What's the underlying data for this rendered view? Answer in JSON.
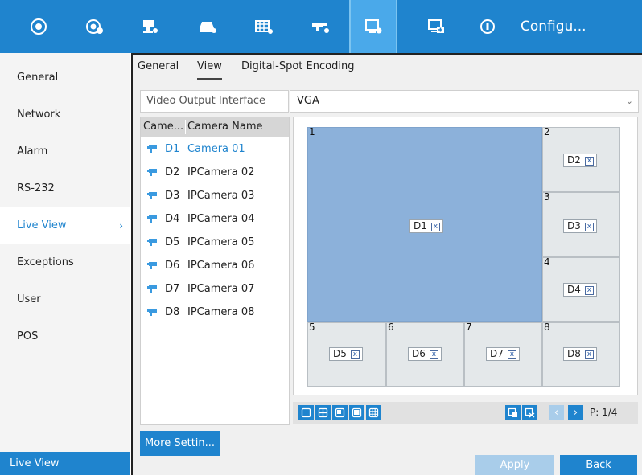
{
  "topbar": {
    "icons": [
      {
        "name": "playback-icon"
      },
      {
        "name": "camera-search-icon"
      },
      {
        "name": "record-icon"
      },
      {
        "name": "hdd-icon"
      },
      {
        "name": "video-config-icon"
      },
      {
        "name": "camera-config-icon"
      },
      {
        "name": "display-config-icon",
        "active": true
      },
      {
        "name": "system-config-icon"
      },
      {
        "name": "info-icon"
      }
    ],
    "title": "Configu..."
  },
  "sidebar": {
    "items": [
      {
        "label": "General"
      },
      {
        "label": "Network"
      },
      {
        "label": "Alarm"
      },
      {
        "label": "RS-232"
      },
      {
        "label": "Live View",
        "active": true
      },
      {
        "label": "Exceptions"
      },
      {
        "label": "User"
      },
      {
        "label": "POS"
      }
    ],
    "active_chevron": "›",
    "bottom_label": "Live View"
  },
  "tabs": [
    {
      "label": "General"
    },
    {
      "label": "View",
      "active": true
    },
    {
      "label": "Digital-Spot Encoding"
    }
  ],
  "output": {
    "label": "Video Output Interface",
    "value": "VGA",
    "arrow": "⌄"
  },
  "camera_list": {
    "headers": [
      "Came...",
      "Camera Name"
    ],
    "rows": [
      {
        "channel": "D1",
        "name": "Camera 01",
        "selected": true
      },
      {
        "channel": "D2",
        "name": "IPCamera 02"
      },
      {
        "channel": "D3",
        "name": "IPCamera 03"
      },
      {
        "channel": "D4",
        "name": "IPCamera 04"
      },
      {
        "channel": "D5",
        "name": "IPCamera 05"
      },
      {
        "channel": "D6",
        "name": "IPCamera 06"
      },
      {
        "channel": "D7",
        "name": "IPCamera 07"
      },
      {
        "channel": "D8",
        "name": "IPCamera 08"
      }
    ]
  },
  "layout": {
    "windows": [
      {
        "num": "1",
        "cam": "D1",
        "x_icon": "x"
      },
      {
        "num": "2",
        "cam": "D2",
        "x_icon": "x"
      },
      {
        "num": "3",
        "cam": "D3",
        "x_icon": "x"
      },
      {
        "num": "4",
        "cam": "D4",
        "x_icon": "x"
      },
      {
        "num": "5",
        "cam": "D5",
        "x_icon": "x"
      },
      {
        "num": "6",
        "cam": "D6",
        "x_icon": "x"
      },
      {
        "num": "7",
        "cam": "D7",
        "x_icon": "x"
      },
      {
        "num": "8",
        "cam": "D8",
        "x_icon": "x"
      }
    ],
    "page": "P: 1/4",
    "prev_icon": "‹",
    "next_icon": "›"
  },
  "buttons": {
    "more": "More Settin...",
    "apply": "Apply",
    "back": "Back"
  },
  "colors": {
    "accent": "#1f84ce",
    "selected_window": "#8cb1da",
    "disabled": "#a9cdea"
  }
}
